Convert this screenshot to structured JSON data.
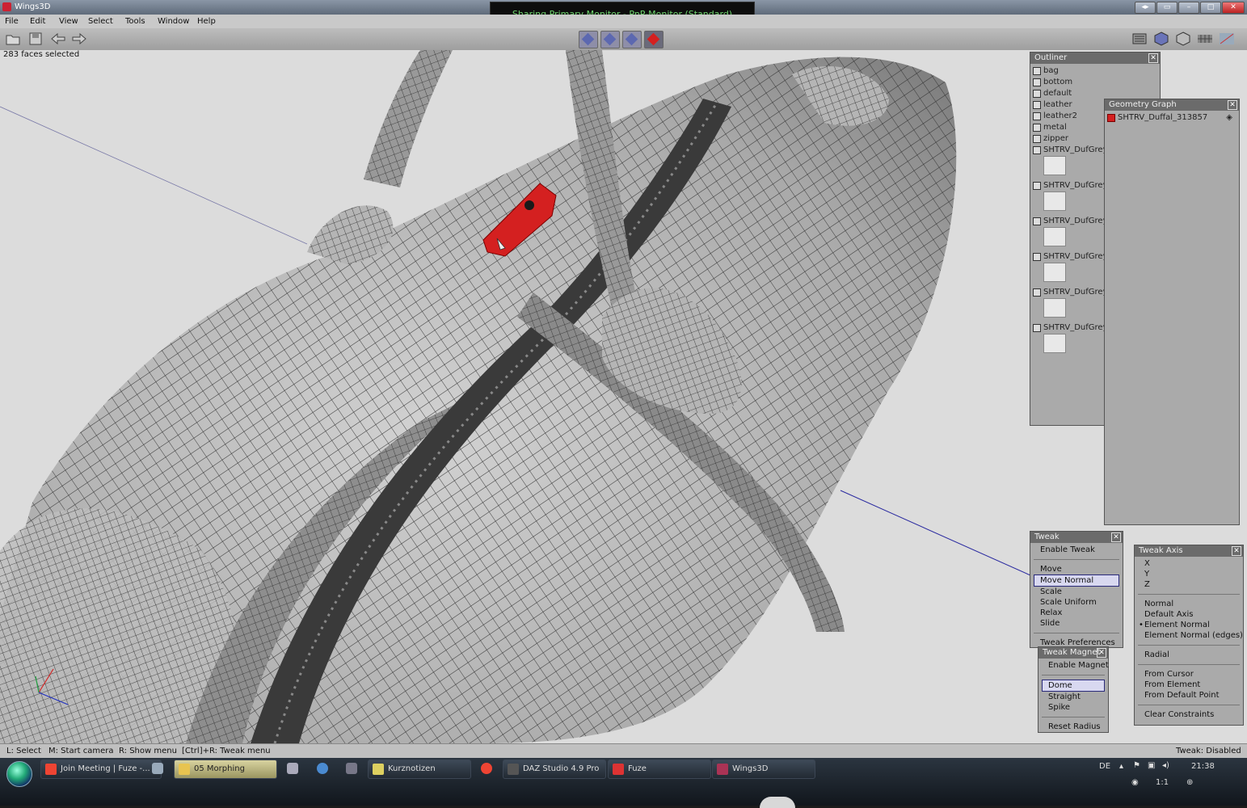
{
  "window": {
    "title": "Wings3D",
    "share_banner": "Sharing Primary Monitor - PnP-Monitor (Standard)"
  },
  "menu": [
    "File",
    "Edit",
    "View",
    "Select",
    "Tools",
    "Window",
    "Help"
  ],
  "status_top": "283 faces selected",
  "outliner": {
    "title": "Outliner",
    "materials": [
      "bag",
      "bottom",
      "default",
      "leather",
      "leather2",
      "metal",
      "zipper"
    ],
    "images": [
      "SHTRV_DufGrey",
      "SHTRV_DufGrey",
      "SHTRV_DufGrey",
      "SHTRV_DufGrey",
      "SHTRV_DufGrey",
      "SHTRV_DufGrey"
    ]
  },
  "geometry_graph": {
    "title": "Geometry Graph",
    "object": "SHTRV_Duffal_313857"
  },
  "tweak": {
    "title": "Tweak",
    "enable": "Enable Tweak",
    "modes": [
      "Move",
      "Move Normal",
      "Scale",
      "Scale Uniform",
      "Relax",
      "Slide"
    ],
    "selected_mode": "Move Normal",
    "preferences": "Tweak Preferences"
  },
  "tweak_magnet": {
    "title": "Tweak Magnet",
    "enable": "Enable Magnet",
    "types": [
      "Dome",
      "Straight",
      "Spike"
    ],
    "selected_type": "Dome",
    "reset": "Reset Radius"
  },
  "tweak_axis": {
    "title": "Tweak Axis",
    "axes": [
      "X",
      "Y",
      "Z"
    ],
    "normals": [
      "Normal",
      "Default Axis",
      "Element Normal",
      "Element Normal (edges)"
    ],
    "selected_normal": "Element Normal",
    "radial": "Radial",
    "from": [
      "From Cursor",
      "From Element",
      "From Default Point"
    ],
    "clear": "Clear Constraints"
  },
  "statusbar": {
    "lmb": "L: Select",
    "mmb": "M: Start camera",
    "rmb": "R: Show menu",
    "ctrl": "[Ctrl]+R: Tweak menu",
    "right": "Tweak: Disabled"
  },
  "taskbar": {
    "tasks": [
      "Join Meeting | Fuze -...",
      "05 Morphing",
      "Kurznotizen",
      "DAZ Studio 4.9 Pro",
      "Fuze",
      "Wings3D"
    ],
    "lang": "DE",
    "time": "21:38",
    "zoom": "1:1"
  },
  "colors": {
    "selection": "#d42020",
    "accent": "#5c68b0",
    "panel": "#aaaaaa",
    "viewport": "#dcdcdc"
  }
}
